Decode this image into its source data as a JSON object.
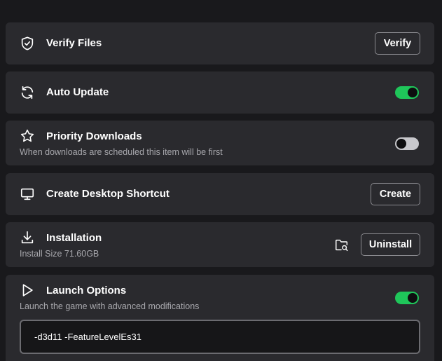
{
  "colors": {
    "background": "#19191c",
    "card": "#2a2a2e",
    "toggle_on": "#1fc65a",
    "toggle_off": "#c8c8cc",
    "subtitle": "#a8a8ad"
  },
  "verify_files": {
    "icon": "shield-check-icon",
    "title": "Verify Files",
    "button_label": "Verify"
  },
  "auto_update": {
    "icon": "refresh-icon",
    "title": "Auto Update",
    "enabled": true
  },
  "priority_downloads": {
    "icon": "star-icon",
    "title": "Priority Downloads",
    "subtitle": "When downloads are scheduled this item will be first",
    "enabled": false
  },
  "desktop_shortcut": {
    "icon": "monitor-icon",
    "title": "Create Desktop Shortcut",
    "button_label": "Create"
  },
  "installation": {
    "icon": "download-icon",
    "title": "Installation",
    "subtitle": "Install Size 71.60GB",
    "folder_icon": "folder-search-icon",
    "button_label": "Uninstall"
  },
  "launch_options": {
    "icon": "play-icon",
    "title": "Launch Options",
    "subtitle": "Launch the game with advanced modifications",
    "enabled": true,
    "input_value": "-d3d11 -FeatureLevelEs31"
  }
}
